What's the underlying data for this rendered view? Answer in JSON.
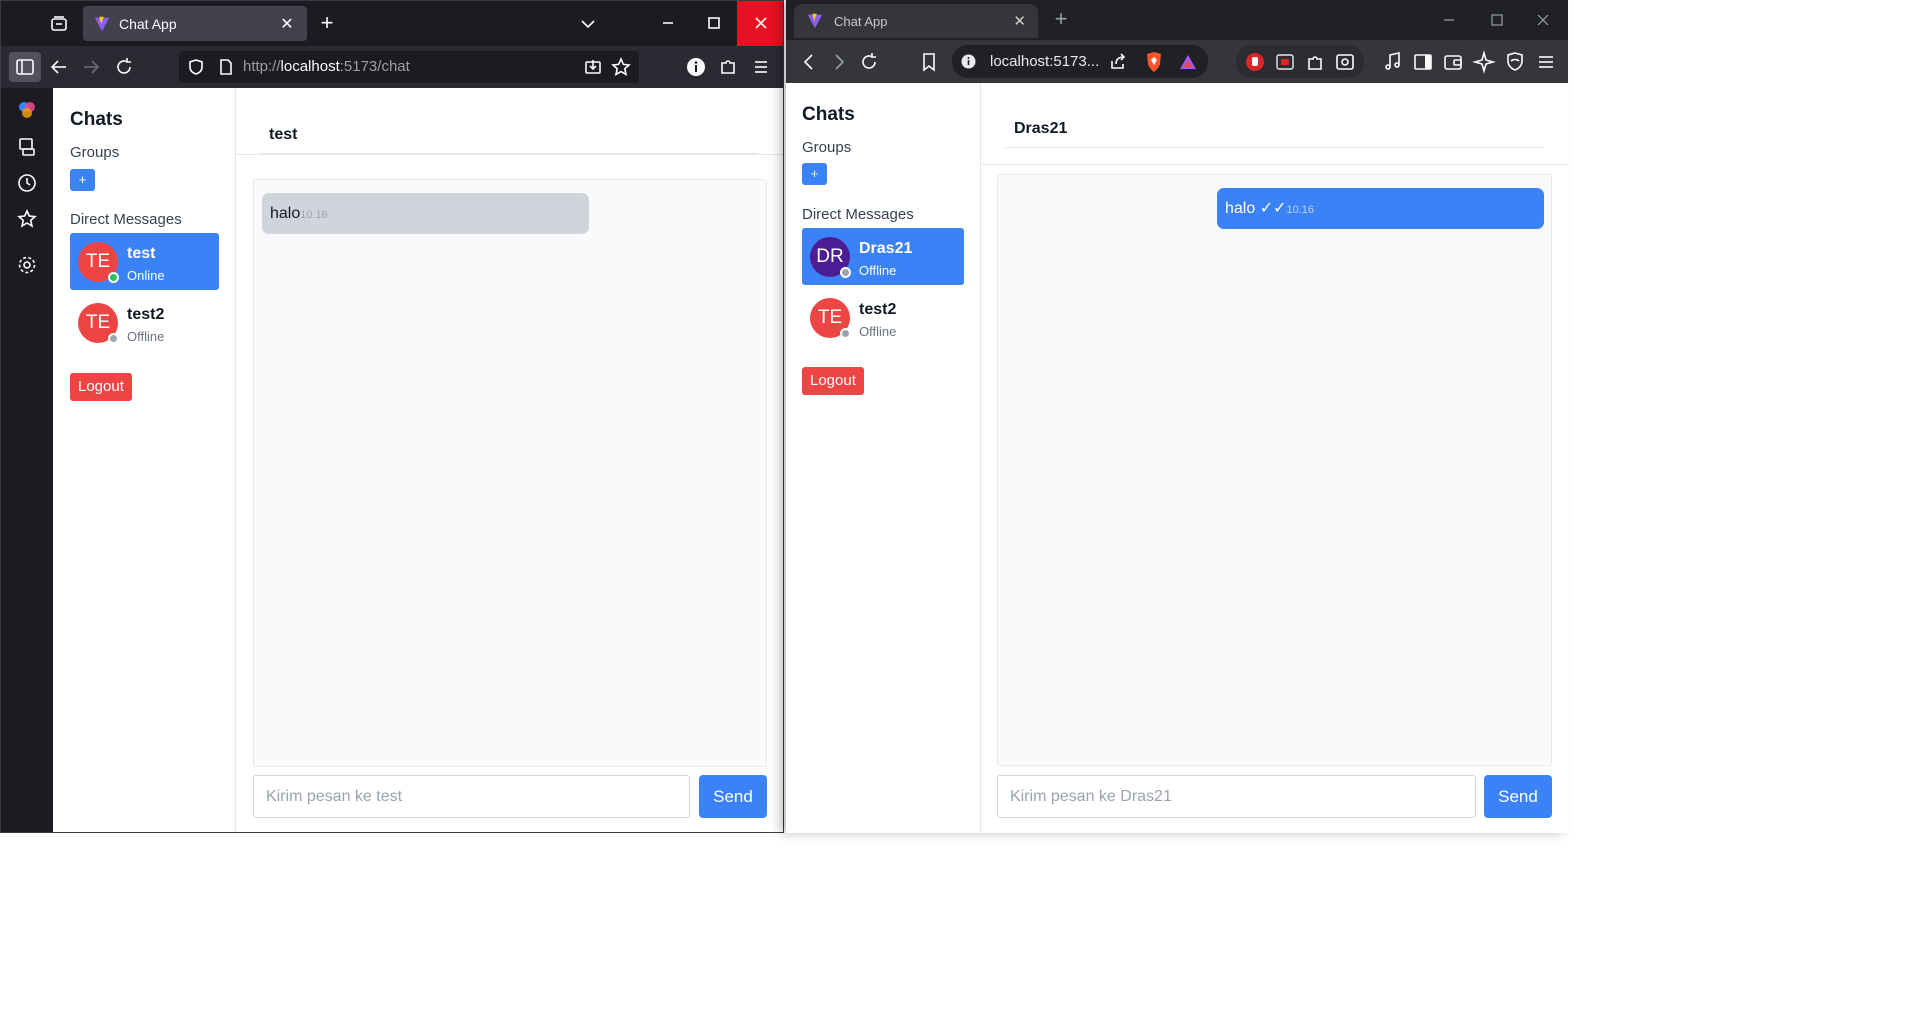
{
  "left_window": {
    "tab_title": "Chat App",
    "url_prefix": "http://",
    "url_host": "localhost",
    "url_path": ":5173/chat",
    "app": {
      "sidebar_title": "Chats",
      "groups_label": "Groups",
      "add_group_label": "+",
      "dm_label": "Direct Messages",
      "contacts": [
        {
          "initials": "TE",
          "name": "test",
          "status": "Online",
          "avatar_color": "#ef4444",
          "status_color": "#22c55e"
        },
        {
          "initials": "TE",
          "name": "test2",
          "status": "Offline",
          "avatar_color": "#ef4444",
          "status_color": "#9ca3af"
        }
      ],
      "logout_label": "Logout",
      "chat_title": "test",
      "messages": [
        {
          "text": "halo",
          "time": "10.16",
          "direction": "incoming"
        }
      ],
      "input_placeholder": "Kirim pesan ke test",
      "send_label": "Send"
    }
  },
  "right_window": {
    "tab_title": "Chat App",
    "url": "localhost:5173...",
    "app": {
      "sidebar_title": "Chats",
      "groups_label": "Groups",
      "add_group_label": "+",
      "dm_label": "Direct Messages",
      "contacts": [
        {
          "initials": "DR",
          "name": "Dras21",
          "status": "Offline",
          "avatar_color": "#4c1d95",
          "status_color": "#9ca3af"
        },
        {
          "initials": "TE",
          "name": "test2",
          "status": "Offline",
          "avatar_color": "#ef4444",
          "status_color": "#9ca3af"
        }
      ],
      "logout_label": "Logout",
      "chat_title": "Dras21",
      "messages": [
        {
          "text": "halo ",
          "ticks": "✓✓",
          "time": "10.16",
          "direction": "outgoing"
        }
      ],
      "input_placeholder": "Kirim pesan ke Dras21",
      "send_label": "Send"
    }
  },
  "colors": {
    "accent": "#3b82f6",
    "danger": "#ef4444",
    "close_red": "#e81123"
  }
}
